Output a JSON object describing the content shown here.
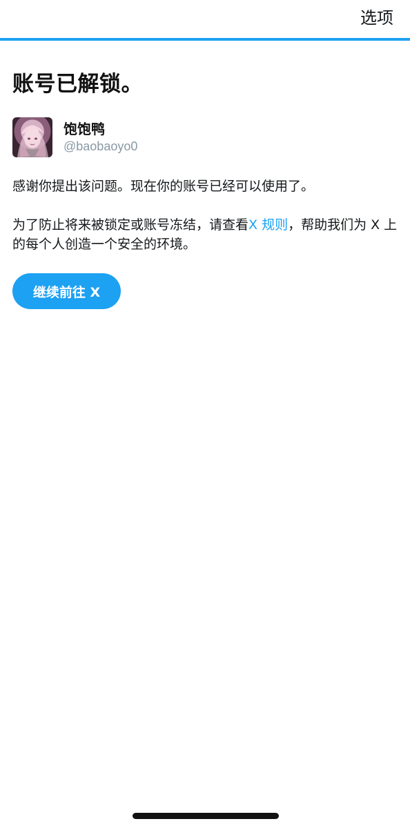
{
  "header": {
    "options_label": "选项"
  },
  "colors": {
    "accent": "#1da1f2",
    "text_primary": "#14171a",
    "text_secondary": "#8899a6"
  },
  "page": {
    "title": "账号已解锁。"
  },
  "profile": {
    "avatar_icon": "anime-avatar-image",
    "display_name": "饱饱鸭",
    "handle": "@baobaoyo0"
  },
  "message": {
    "paragraph_1": "感谢你提出该问题。现在你的账号已经可以使用了。",
    "paragraph_2_before": "为了防止将来被锁定或账号冻结，请查看",
    "rules_link": "X 规则",
    "paragraph_2_after": "，帮助我们为 X 上的每个人创造一个安全的环境。"
  },
  "actions": {
    "continue_label": "继续前往 X"
  }
}
